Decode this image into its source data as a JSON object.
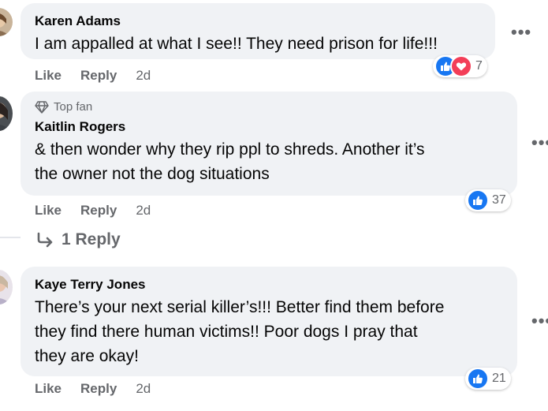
{
  "comments": [
    {
      "author": "Karen Adams",
      "text": "I am appalled at what I see!! They need prison for life!!!",
      "like_label": "Like",
      "reply_label": "Reply",
      "time": "2d",
      "reaction_count": "7",
      "reactions": [
        "like-icon",
        "love-icon"
      ]
    },
    {
      "badge": "Top fan",
      "author": "Kaitlin Rogers",
      "text_line1": "& then wonder why they rip ppl to shreds. Another it’s",
      "text_line2": "the owner not the dog situations",
      "like_label": "Like",
      "reply_label": "Reply",
      "time": "2d",
      "reaction_count": "37",
      "reactions": [
        "like-icon"
      ]
    },
    {
      "author": "Kaye Terry Jones",
      "text_line1": "There’s your next serial killer’s!!! Better find them before",
      "text_line2": "they find there human victims!! Poor dogs I pray that",
      "text_line3": "they are okay!",
      "like_label": "Like",
      "reply_label": "Reply",
      "time": "2d",
      "reaction_count": "21",
      "reactions": [
        "like-icon"
      ]
    }
  ],
  "replies_link": "1 Reply",
  "colors": {
    "bubble": "#f0f2f5",
    "secondary_text": "#65676b",
    "like_blue": "#1877f2",
    "love_red": "#f33e58"
  }
}
